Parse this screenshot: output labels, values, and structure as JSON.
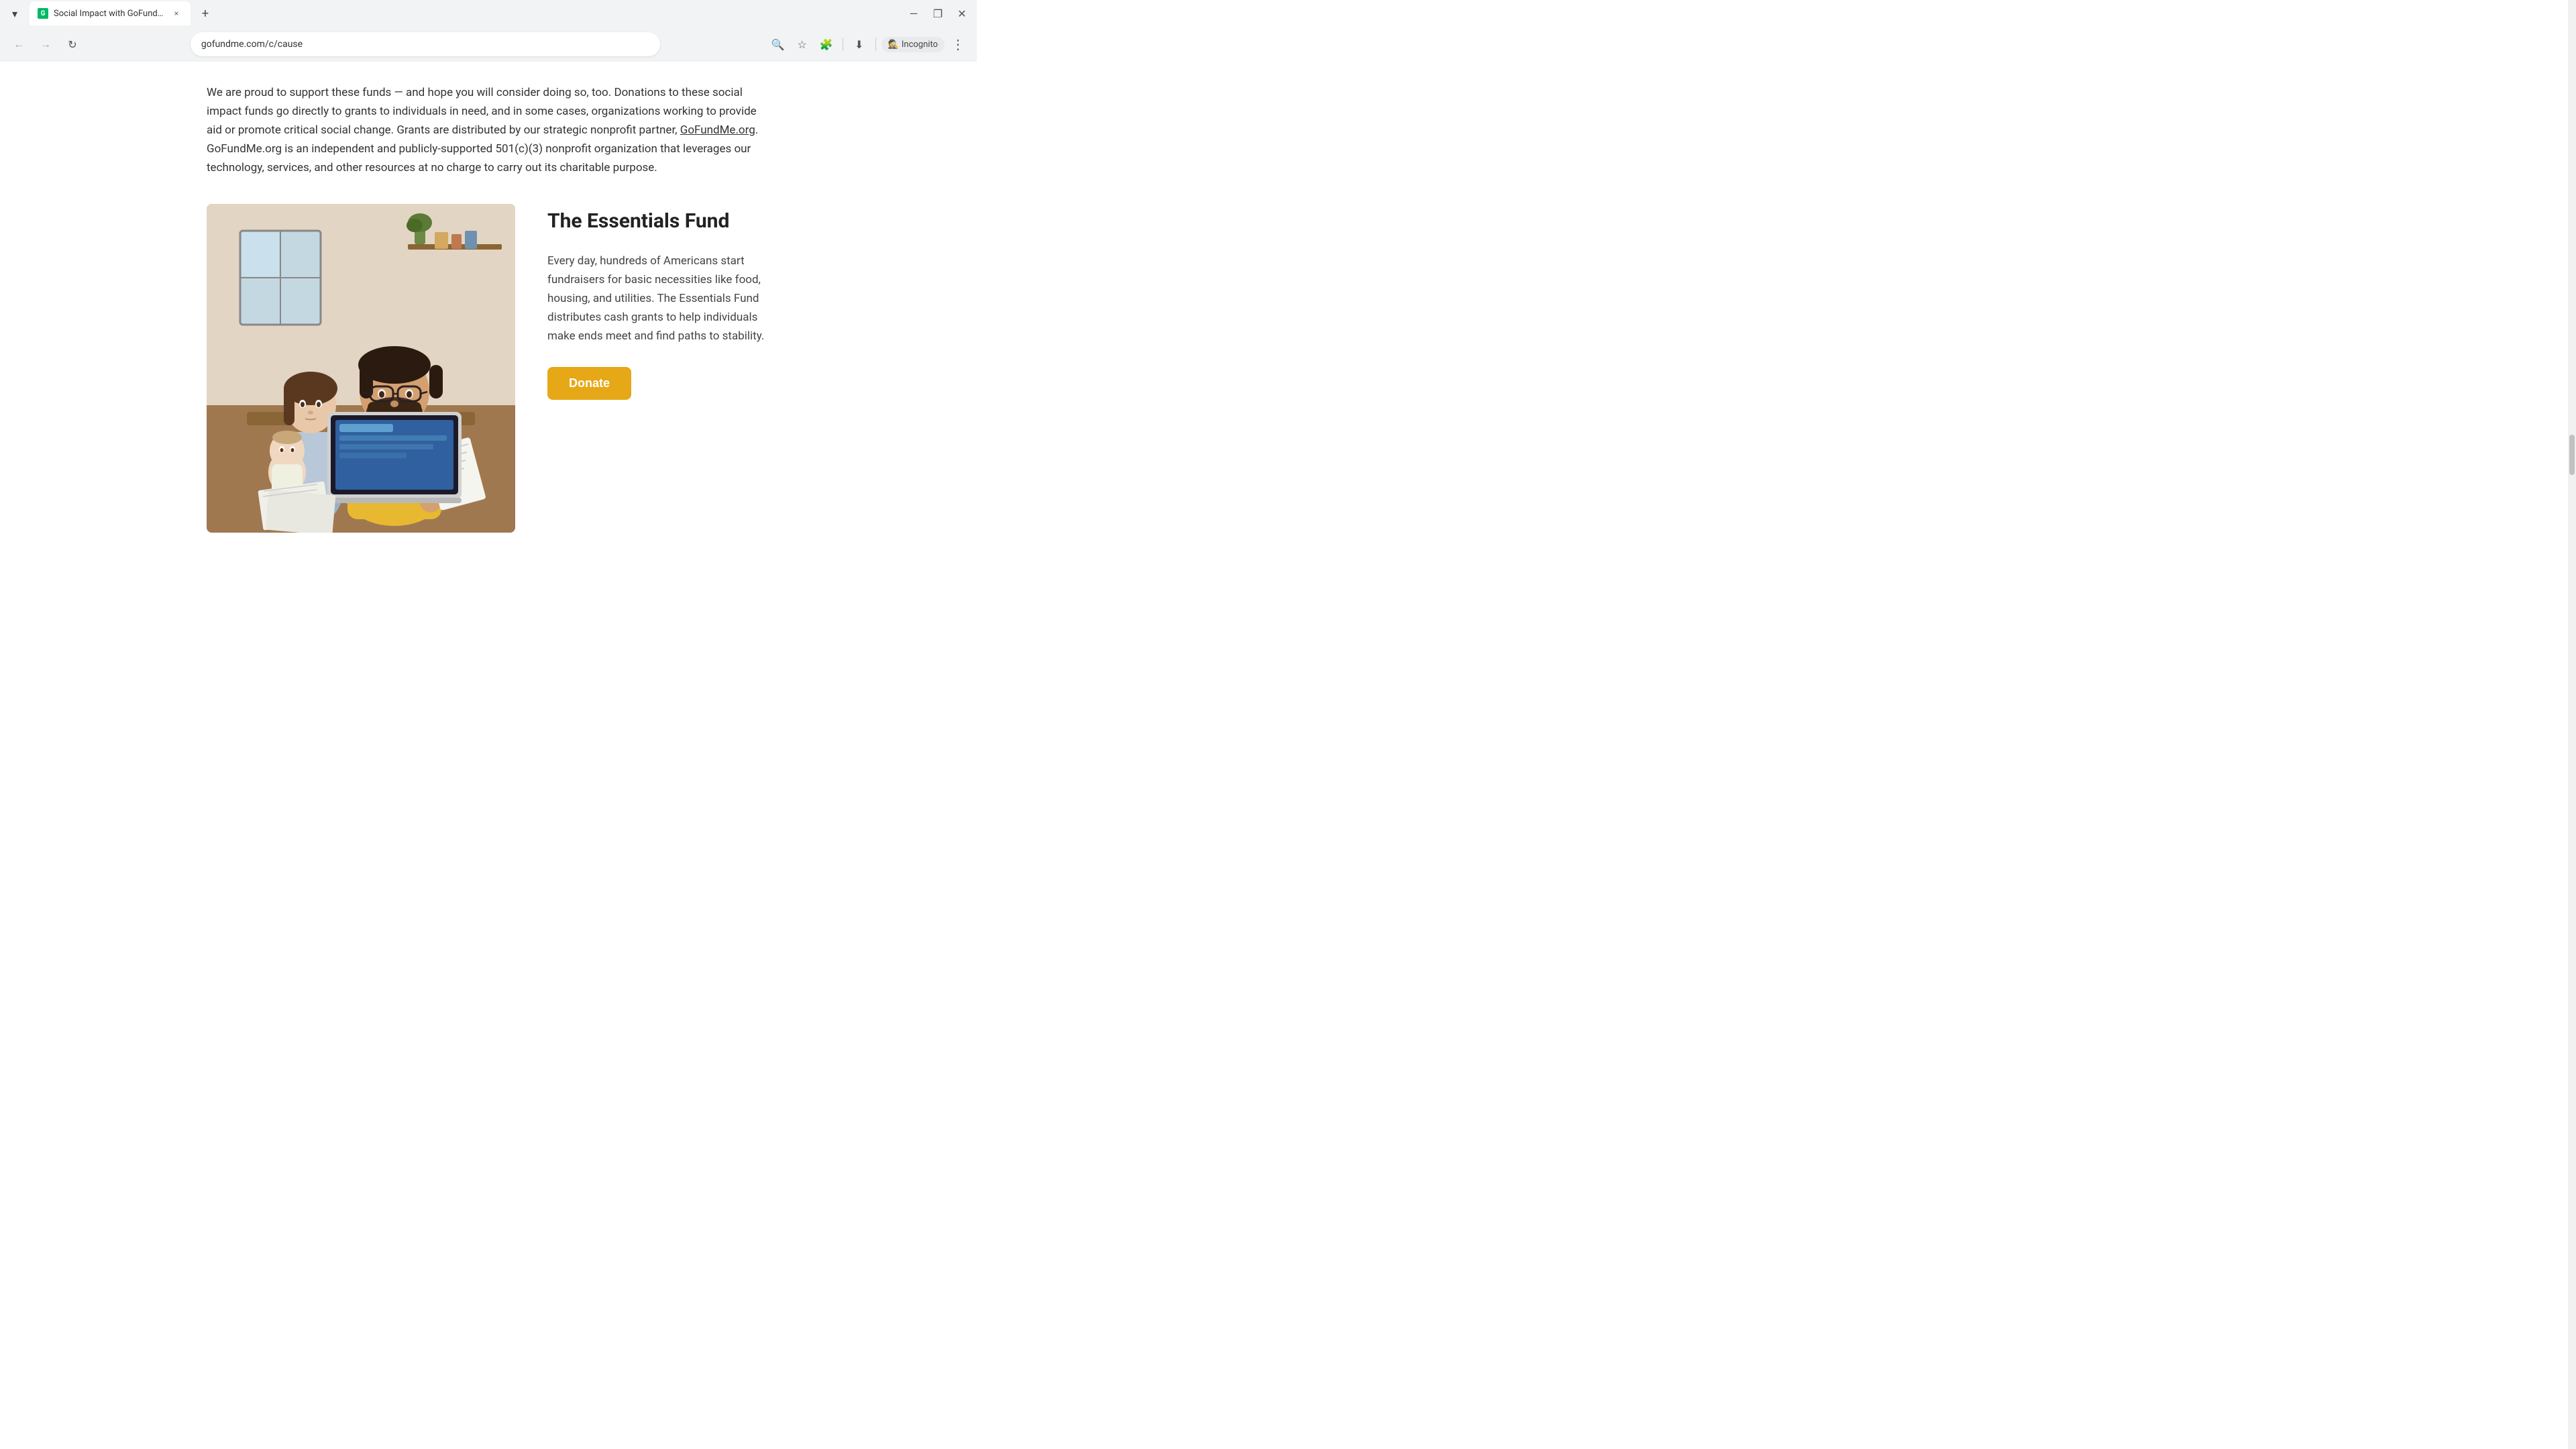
{
  "browser": {
    "tab": {
      "favicon_letter": "G",
      "title": "Social Impact with GoFundMe...",
      "close_label": "×"
    },
    "new_tab_label": "+",
    "window_controls": {
      "minimize": "—",
      "restore": "❐",
      "close": "✕"
    },
    "nav": {
      "back_label": "←",
      "forward_label": "→",
      "reload_label": "↻"
    },
    "address": "gofundme.com/c/cause",
    "toolbar": {
      "search_icon": "🔍",
      "bookmark_icon": "☆",
      "extensions_icon": "🧩",
      "download_icon": "⬇",
      "incognito_label": "Incognito",
      "more_label": "⋮"
    }
  },
  "page": {
    "intro": {
      "text": "We are proud to support these funds — and hope you will consider doing so, too. Donations to these social impact funds go directly to grants to individuals in need, and in some cases, organizations working to provide aid or promote critical social change. Grants are distributed by our strategic nonprofit partner, GoFundMe.org. GoFundMe.org is an independent and publicly-supported 501(c)(3) nonprofit organization that leverages our technology, services, and other resources at no charge to carry out its charitable purpose.",
      "link_text": "GoFundMe.org"
    },
    "essentials_fund": {
      "title": "The Essentials Fund",
      "description": "Every day, hundreds of Americans start fundraisers for basic necessities like food, housing, and utilities. The Essentials Fund distributes cash grants to help individuals make ends meet and find paths to stability.",
      "donate_button_label": "Donate",
      "image_alt": "Family with baby looking at documents on laptop"
    }
  },
  "colors": {
    "donate_button_bg": "#e6a817",
    "donate_button_text": "#ffffff",
    "link_color": "#333333",
    "title_color": "#222222",
    "body_text": "#444444"
  }
}
